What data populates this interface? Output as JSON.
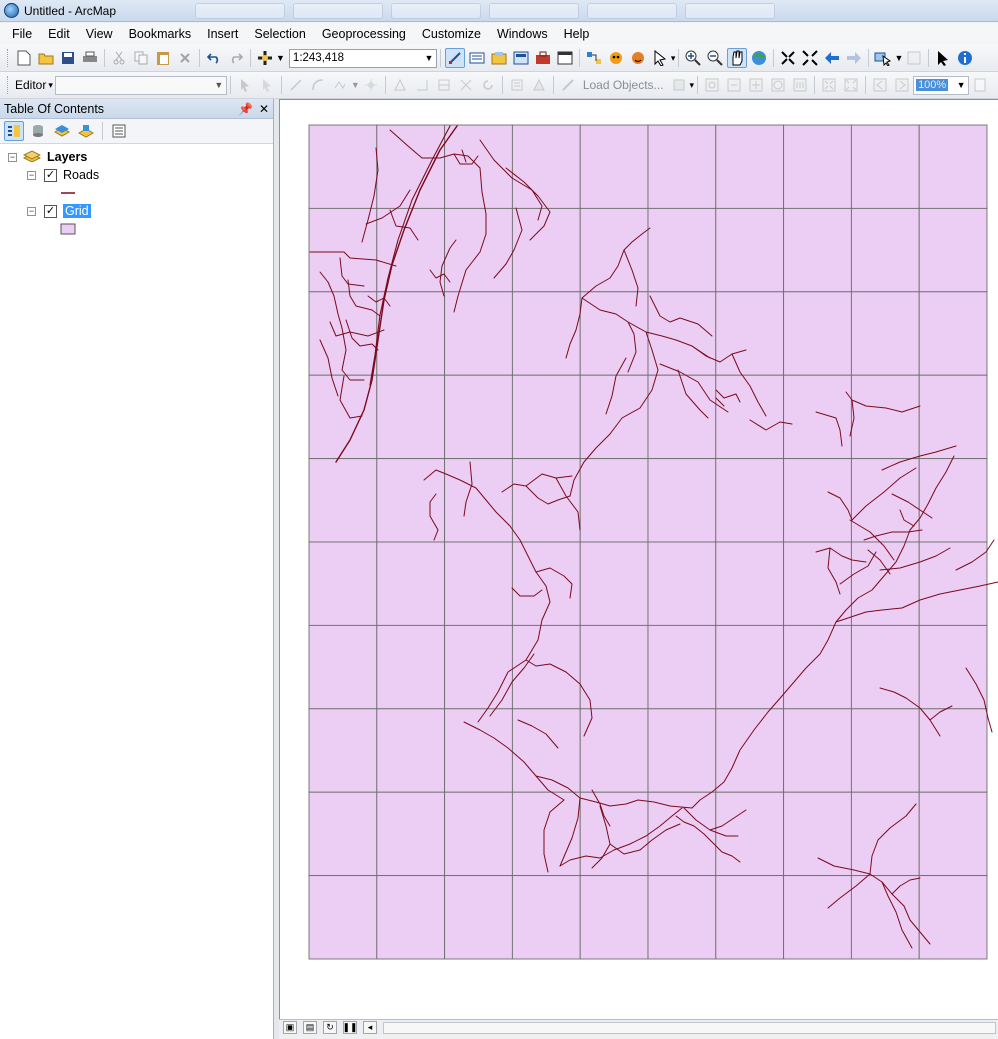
{
  "window": {
    "title": "Untitled - ArcMap"
  },
  "menu": {
    "items": [
      "File",
      "Edit",
      "View",
      "Bookmarks",
      "Insert",
      "Selection",
      "Geoprocessing",
      "Customize",
      "Windows",
      "Help"
    ]
  },
  "toolbar": {
    "scale_value": "1:243,418"
  },
  "editor_toolbar": {
    "editor_label": "Editor",
    "load_objects_label": "Load Objects...",
    "zoom_value": "100%"
  },
  "toc": {
    "title": "Table Of Contents",
    "root_label": "Layers",
    "layers": [
      {
        "name": "Roads",
        "checked": true,
        "symbol_color": "#7a0a1e"
      },
      {
        "name": "Grid",
        "checked": true,
        "selected": true,
        "symbol_color": "#eccdf3"
      }
    ]
  },
  "map": {
    "grid_fill": "#eccdf3",
    "grid_line": "#6e6e6e",
    "road_color": "#7a0a1e",
    "grid_columns": 10,
    "grid_rows": 10
  }
}
